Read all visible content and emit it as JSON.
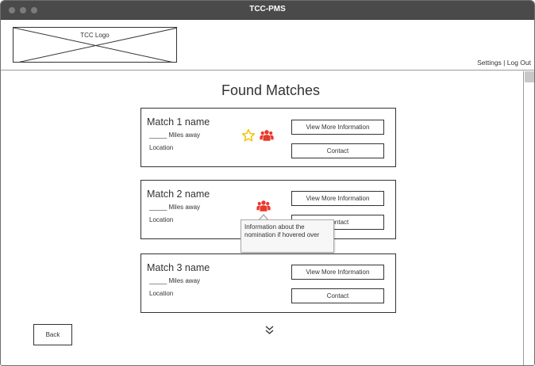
{
  "window": {
    "title": "TCC-PMS"
  },
  "header": {
    "logo_label": "TCC Logo",
    "settings_label": "Settings",
    "separator": " | ",
    "logout_label": "Log Out"
  },
  "main": {
    "title": "Found Matches",
    "matches": [
      {
        "name": "Match 1 name",
        "miles": "_____ Miles away",
        "location": "Location",
        "view_label": "View More Information",
        "contact_label": "Contact",
        "favorite_icon": "star-outline-icon",
        "group_icon": "group-icon"
      },
      {
        "name": "Match 2 name",
        "miles": "_____ Miles away",
        "location": "Location",
        "view_label": "View More Information",
        "contact_label": "Contact",
        "group_icon": "group-icon"
      },
      {
        "name": "Match 3 name",
        "miles": "_____ Miles away",
        "location": "Location",
        "view_label": "View More Information",
        "contact_label": "Contact"
      }
    ],
    "tooltip_text": "Information about the nomination if hovered over",
    "back_label": "Back",
    "more_icon": "double-chevron-down-icon"
  },
  "colors": {
    "titlebar": "#4a4a4a",
    "star": "#f5c400",
    "group": "#e8392c"
  }
}
